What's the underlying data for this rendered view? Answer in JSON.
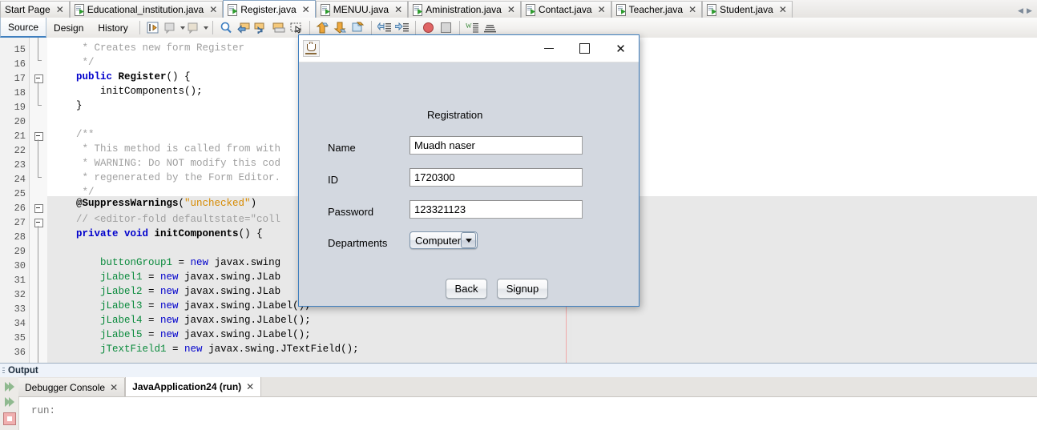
{
  "editor_tabs": [
    {
      "label": "Start Page",
      "icon": "none",
      "selected": false,
      "closable": true
    },
    {
      "label": "Educational_institution.java",
      "icon": "java-file-icon",
      "selected": false,
      "closable": true
    },
    {
      "label": "Register.java",
      "icon": "java-file-icon",
      "selected": true,
      "closable": true
    },
    {
      "label": "MENUU.java",
      "icon": "java-file-icon",
      "selected": false,
      "closable": true
    },
    {
      "label": "Aministration.java",
      "icon": "java-file-icon",
      "selected": false,
      "closable": true
    },
    {
      "label": "Contact.java",
      "icon": "java-file-icon",
      "selected": false,
      "closable": true
    },
    {
      "label": "Teacher.java",
      "icon": "java-file-icon",
      "selected": false,
      "closable": true
    },
    {
      "label": "Student.java",
      "icon": "java-file-icon",
      "selected": false,
      "closable": true
    }
  ],
  "tab_scroll": {
    "left": "◀",
    "right": "▶"
  },
  "close_glyph": "✕",
  "view_tabs": [
    {
      "label": "Source",
      "selected": true
    },
    {
      "label": "Design",
      "selected": false
    },
    {
      "label": "History",
      "selected": false
    }
  ],
  "toolbar_icons": [
    "last-edit-icon",
    "comment-icon",
    "uncomment-icon",
    "find-selection-icon",
    "previous-bookmark-icon",
    "next-bookmark-icon",
    "toggle-bookmark-icon",
    "select-rectangle-icon",
    "shift-up-icon",
    "shift-down-icon",
    "move-icon",
    "shift-left-icon",
    "shift-right-icon",
    "toggle-breakpoint-icon",
    "stop-icon",
    "format-icon",
    "inspect-icon"
  ],
  "code": {
    "first_line": 15,
    "margin_column_label": "80",
    "lines": [
      {
        "n": 15,
        "indent": 4,
        "segments": [
          {
            "t": " * Creates new form Register",
            "c": "cmt"
          }
        ]
      },
      {
        "n": 16,
        "indent": 4,
        "segments": [
          {
            "t": " */",
            "c": "cmt"
          }
        ]
      },
      {
        "n": 17,
        "indent": 4,
        "segments": [
          {
            "t": "public ",
            "c": "kw"
          },
          {
            "t": "Register",
            "c": "ann"
          },
          {
            "t": "() {",
            "c": ""
          }
        ]
      },
      {
        "n": 18,
        "indent": 4,
        "segments": [
          {
            "t": "    initComponents();",
            "c": ""
          }
        ]
      },
      {
        "n": 19,
        "indent": 4,
        "segments": [
          {
            "t": "}",
            "c": ""
          }
        ]
      },
      {
        "n": 20,
        "indent": 4,
        "segments": [
          {
            "t": "",
            "c": ""
          }
        ]
      },
      {
        "n": 21,
        "indent": 4,
        "segments": [
          {
            "t": "/**",
            "c": "cmt"
          }
        ]
      },
      {
        "n": 22,
        "indent": 4,
        "segments": [
          {
            "t": " * This method is called from with",
            "c": "cmt"
          }
        ]
      },
      {
        "n": 23,
        "indent": 4,
        "segments": [
          {
            "t": " * WARNING: Do NOT modify this cod",
            "c": "cmt"
          }
        ]
      },
      {
        "n": 24,
        "indent": 4,
        "segments": [
          {
            "t": " * regenerated by the Form Editor.",
            "c": "cmt"
          }
        ]
      },
      {
        "n": 25,
        "indent": 4,
        "segments": [
          {
            "t": " */",
            "c": "cmt"
          }
        ]
      },
      {
        "n": 26,
        "indent": 4,
        "segments": [
          {
            "t": "@SuppressWarnings",
            "c": "ann"
          },
          {
            "t": "(",
            "c": ""
          },
          {
            "t": "\"unchecked\"",
            "c": "str"
          },
          {
            "t": ")",
            "c": ""
          }
        ]
      },
      {
        "n": 27,
        "indent": 4,
        "segments": [
          {
            "t": "// <editor-fold defaultstate=\"coll",
            "c": "cmt"
          }
        ]
      },
      {
        "n": 28,
        "indent": 4,
        "segments": [
          {
            "t": "private void ",
            "c": "kw"
          },
          {
            "t": "initComponents",
            "c": "ann"
          },
          {
            "t": "() {",
            "c": ""
          }
        ]
      },
      {
        "n": 29,
        "indent": 4,
        "segments": [
          {
            "t": "",
            "c": ""
          }
        ]
      },
      {
        "n": 30,
        "indent": 4,
        "segments": [
          {
            "t": "    buttonGroup1",
            "c": "fld"
          },
          {
            "t": " = ",
            "c": ""
          },
          {
            "t": "new ",
            "c": "kw2"
          },
          {
            "t": "javax.swing",
            "c": ""
          }
        ]
      },
      {
        "n": 31,
        "indent": 4,
        "segments": [
          {
            "t": "    jLabel1",
            "c": "fld"
          },
          {
            "t": " = ",
            "c": ""
          },
          {
            "t": "new ",
            "c": "kw2"
          },
          {
            "t": "javax.swing.JLab",
            "c": ""
          }
        ]
      },
      {
        "n": 32,
        "indent": 4,
        "segments": [
          {
            "t": "    jLabel2",
            "c": "fld"
          },
          {
            "t": " = ",
            "c": ""
          },
          {
            "t": "new ",
            "c": "kw2"
          },
          {
            "t": "javax.swing.JLab",
            "c": ""
          }
        ]
      },
      {
        "n": 33,
        "indent": 4,
        "segments": [
          {
            "t": "    jLabel3",
            "c": "fld"
          },
          {
            "t": " = ",
            "c": ""
          },
          {
            "t": "new ",
            "c": "kw2"
          },
          {
            "t": "javax.swing.JLabel();",
            "c": ""
          }
        ]
      },
      {
        "n": 34,
        "indent": 4,
        "segments": [
          {
            "t": "    jLabel4",
            "c": "fld"
          },
          {
            "t": " = ",
            "c": ""
          },
          {
            "t": "new ",
            "c": "kw2"
          },
          {
            "t": "javax.swing.JLabel();",
            "c": ""
          }
        ]
      },
      {
        "n": 35,
        "indent": 4,
        "segments": [
          {
            "t": "    jLabel5",
            "c": "fld"
          },
          {
            "t": " = ",
            "c": ""
          },
          {
            "t": "new ",
            "c": "kw2"
          },
          {
            "t": "javax.swing.JLabel();",
            "c": ""
          }
        ]
      },
      {
        "n": 36,
        "indent": 4,
        "segments": [
          {
            "t": "    jTextField1",
            "c": "fld"
          },
          {
            "t": " = ",
            "c": ""
          },
          {
            "t": "new ",
            "c": "kw2"
          },
          {
            "t": "javax.swing.JTextField();",
            "c": ""
          }
        ]
      }
    ]
  },
  "dialog": {
    "icon": "java-cup-icon",
    "title": "",
    "minimize": "—",
    "maximize": "□",
    "close": "✕",
    "heading": "Registration",
    "fields": [
      {
        "label": "Name",
        "value": "Muadh naser",
        "type": "text"
      },
      {
        "label": "ID",
        "value": "1720300",
        "type": "text"
      },
      {
        "label": "Password",
        "value": "123321123",
        "type": "text"
      }
    ],
    "combo": {
      "label": "Departments",
      "value": "Computer",
      "arrow": "▼"
    },
    "buttons": [
      {
        "label": "Back"
      },
      {
        "label": "Signup"
      }
    ]
  },
  "output": {
    "panel_title": "Output",
    "tabs": [
      {
        "label": "Debugger Console",
        "selected": false
      },
      {
        "label": "JavaApplication24 (run)",
        "selected": true
      }
    ],
    "console_text": "run:",
    "rail_icons": [
      "step-forward-icon",
      "step-forward-icon",
      "stop-process-icon"
    ]
  },
  "colors": {
    "accent": "#3f7fbf",
    "dialog_bg": "#d3d8e0",
    "comment": "#a0a0a0",
    "keyword": "#0000cc",
    "field": "#0a8a3c",
    "string": "#d68a00",
    "margin_line": "#f0a8a8"
  }
}
